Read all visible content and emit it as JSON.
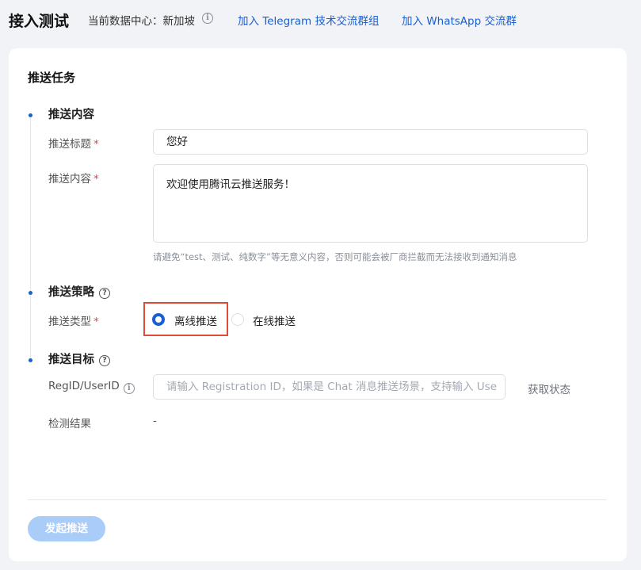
{
  "header": {
    "title": "接入测试",
    "datacenter_label": "当前数据中心：新加坡",
    "telegram_link": "加入 Telegram 技术交流群组",
    "whatsapp_link": "加入 WhatsApp 交流群"
  },
  "card": {
    "title": "推送任务",
    "content_section": {
      "title": "推送内容",
      "title_label": "推送标题",
      "title_value": "您好",
      "content_label": "推送内容",
      "content_value": "欢迎使用腾讯云推送服务！",
      "hint": "请避免“test、测试、纯数字”等无意义内容，否则可能会被厂商拦截而无法接收到通知消息"
    },
    "strategy_section": {
      "title": "推送策略",
      "type_label": "推送类型",
      "options": [
        "离线推送",
        "在线推送"
      ],
      "selected": "离线推送"
    },
    "target_section": {
      "title": "推送目标",
      "regid_label": "RegID/UserID",
      "regid_placeholder": "请输入 Registration ID，如果是 Chat 消息推送场景，支持输入 Use",
      "get_status": "获取状态",
      "result_label": "检测结果",
      "result_value": "-"
    },
    "submit_label": "发起推送"
  },
  "colors": {
    "accent": "#1a5fd1",
    "required": "#e54545",
    "highlight_border": "#e04a3b",
    "submit_disabled": "#a9ccf9"
  },
  "icons": {
    "required_mark": "*",
    "info": "i",
    "help": "?"
  }
}
